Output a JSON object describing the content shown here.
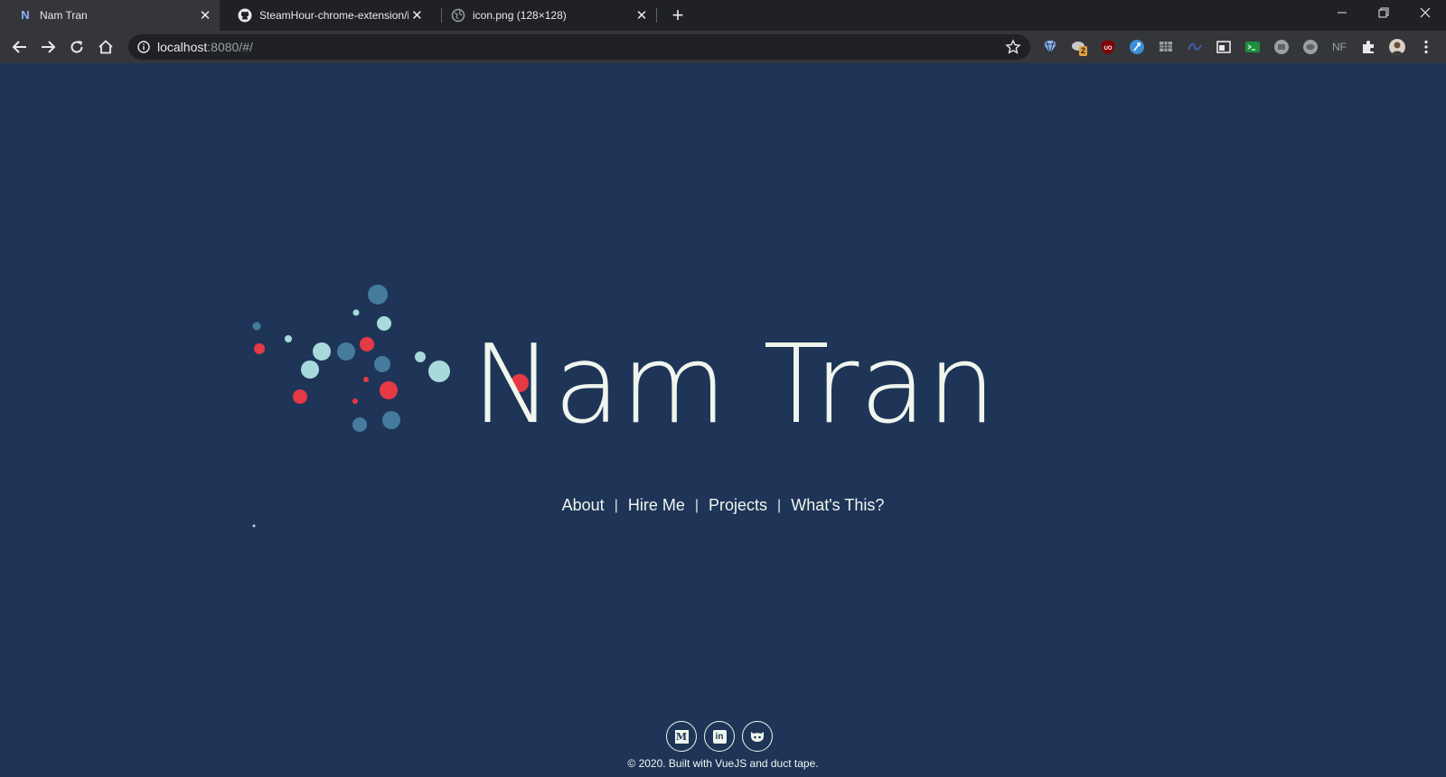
{
  "browser": {
    "tabs": [
      {
        "title": "Nam Tran",
        "favicon_letter": "N",
        "active": true
      },
      {
        "title": "SteamHour-chrome-extension/ic",
        "favicon": "github-icon",
        "active": false
      },
      {
        "title": "icon.png (128×128)",
        "favicon": "globe-icon",
        "active": false
      }
    ],
    "address": {
      "host": "localhost",
      "rest": ":8080/#/"
    },
    "extension_badge": "2",
    "extension_text": "NF",
    "icons": [
      "back-icon",
      "forward-icon",
      "reload-icon",
      "home-icon",
      "info-icon",
      "star-icon",
      "extensions-icon",
      "menu-icon",
      "profile-avatar"
    ]
  },
  "page": {
    "name": "Nam Tran",
    "nav": [
      {
        "label": "About"
      },
      {
        "label": "Hire Me"
      },
      {
        "label": "Projects"
      },
      {
        "label": "What's This?"
      }
    ],
    "nav_separator": "|",
    "social": [
      {
        "icon": "medium-icon",
        "glyph": "M"
      },
      {
        "icon": "linkedin-icon",
        "glyph": "in"
      },
      {
        "icon": "github-icon"
      }
    ],
    "footer": "© 2020. Built with VueJS and duct tape."
  },
  "colors": {
    "background": "#1e3557",
    "text": "#f0f6ee",
    "dot_red": "#e63946",
    "dot_light": "#a8dadc",
    "dot_mid": "#457b9d"
  }
}
